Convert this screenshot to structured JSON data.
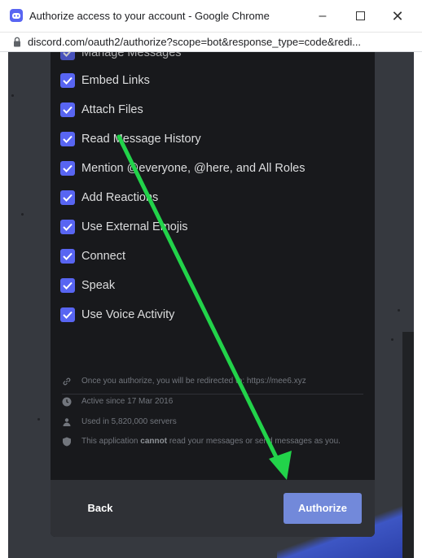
{
  "window": {
    "title": "Authorize access to your account - Google Chrome",
    "minimize": "–",
    "close": "✕",
    "app_icon": "discord-icon"
  },
  "address": {
    "url": "discord.com/oauth2/authorize?scope=bot&response_type=code&redi..."
  },
  "permissions": {
    "partial_label": "Manage Messages",
    "items": [
      {
        "label": "Embed Links",
        "checked": true
      },
      {
        "label": "Attach Files",
        "checked": true
      },
      {
        "label": "Read Message History",
        "checked": true
      },
      {
        "label": "Mention @everyone, @here, and All Roles",
        "checked": true
      },
      {
        "label": "Add Reactions",
        "checked": true
      },
      {
        "label": "Use External Emojis",
        "checked": true
      },
      {
        "label": "Connect",
        "checked": true
      },
      {
        "label": "Speak",
        "checked": true
      },
      {
        "label": "Use Voice Activity",
        "checked": true
      }
    ]
  },
  "info": {
    "redirect": "Once you authorize, you will be redirected to: https://mee6.xyz",
    "active_since": "Active since 17 Mar 2016",
    "servers": "Used in 5,820,000 servers",
    "privacy_prefix": "This application ",
    "privacy_bold": "cannot",
    "privacy_suffix": " read your messages or send messages as you."
  },
  "footer": {
    "back_label": "Back",
    "authorize_label": "Authorize"
  },
  "colors": {
    "accent": "#5865f2",
    "authorize_button": "#7289da",
    "annotation_arrow": "#22d34a"
  }
}
